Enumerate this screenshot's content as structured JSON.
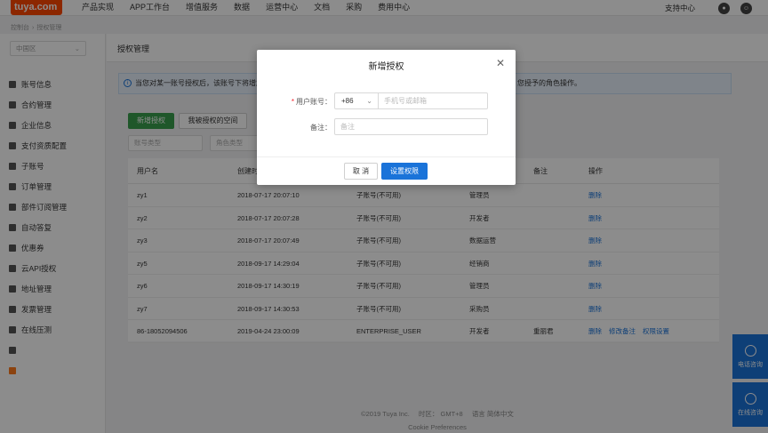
{
  "topbar": {
    "logo": "tuya.com",
    "nav": [
      "产品实现",
      "APP工作台",
      "增值服务",
      "数据",
      "运营中心",
      "文档",
      "采购",
      "费用中心"
    ],
    "support": "支持中心"
  },
  "breadcrumb": [
    "控制台",
    "授权管理"
  ],
  "region": "中国区",
  "sidebar": [
    "账号信息",
    "合约管理",
    "企业信息",
    "支付资质配置",
    "子账号",
    "订单管理",
    "部件订阅管理",
    "自动答复",
    "优惠券",
    "云API授权",
    "地址管理",
    "发票管理",
    "在线压测"
  ],
  "page_title": "授权管理",
  "info_text": "当您对某一账号授权后，该账号下将增加",
  "info_text_right": "您授予的角色操作。",
  "buttons": {
    "add_auth": "新增授权",
    "authorized_space": "我被授权的空间"
  },
  "filters": {
    "account_type": "账号类型",
    "role_type": "角色类型"
  },
  "table": {
    "headers": [
      "用户名",
      "创建时",
      "",
      "",
      "备注",
      "操作"
    ],
    "rows": [
      {
        "user": "zy1",
        "created": "2018-07-17 20:07:10",
        "type": "子账号(不可用)",
        "role": "管理员",
        "note": "",
        "actions": [
          "删除"
        ]
      },
      {
        "user": "zy2",
        "created": "2018-07-17 20:07:28",
        "type": "子账号(不可用)",
        "role": "开发者",
        "note": "",
        "actions": [
          "删除"
        ]
      },
      {
        "user": "zy3",
        "created": "2018-07-17 20:07:49",
        "type": "子账号(不可用)",
        "role": "数据运营",
        "note": "",
        "actions": [
          "删除"
        ]
      },
      {
        "user": "zy5",
        "created": "2018-09-17 14:29:04",
        "type": "子账号(不可用)",
        "role": "经销商",
        "note": "",
        "actions": [
          "删除"
        ]
      },
      {
        "user": "zy6",
        "created": "2018-09-17 14:30:19",
        "type": "子账号(不可用)",
        "role": "管理员",
        "note": "",
        "actions": [
          "删除"
        ]
      },
      {
        "user": "zy7",
        "created": "2018-09-17 14:30:53",
        "type": "子账号(不可用)",
        "role": "采购员",
        "note": "",
        "actions": [
          "删除"
        ]
      },
      {
        "user": "86-18052094506",
        "created": "2019-04-24 23:00:09",
        "type": "ENTERPRISE_USER",
        "role": "开发者",
        "note": "重丽君",
        "actions": [
          "删除",
          "修改备注",
          "权限设置"
        ]
      }
    ]
  },
  "footer": {
    "copyright": "©2019 Tuya Inc.",
    "region_label": "时区：",
    "timezone": "GMT+8",
    "lang_label": "语言",
    "language": "简体中文",
    "cookie": "Cookie Preferences"
  },
  "floating": {
    "phone": "电话咨询",
    "online": "在线咨询"
  },
  "modal": {
    "title": "新增授权",
    "account_label": "用户账号：",
    "country_code": "+86",
    "phone_placeholder": "手机号或邮箱",
    "note_label": "备注：",
    "note_placeholder": "备注",
    "cancel": "取 消",
    "confirm": "设置权限"
  }
}
